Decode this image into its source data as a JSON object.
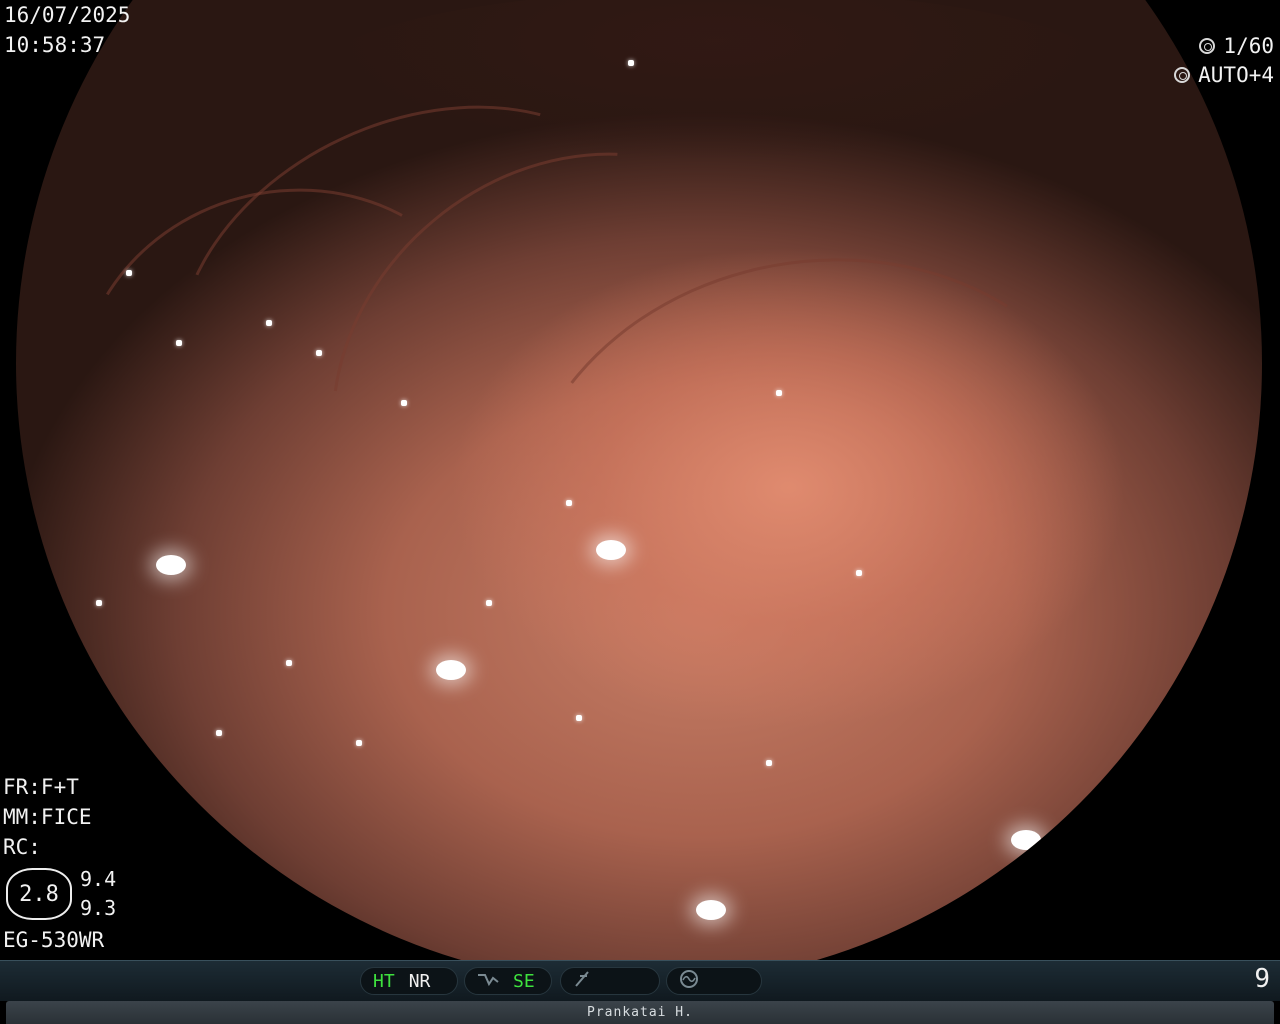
{
  "osd": {
    "date": "16/07/2025",
    "time": "10:58:37",
    "shutter": "1/60",
    "gain": "AUTO+4",
    "fr": "FR:F+T",
    "mm": "MM:FICE",
    "rc": "RC:",
    "zoom": "2.8",
    "zoom_a": "9.4",
    "zoom_b": "9.3",
    "scope_model": "EG-530WR"
  },
  "status_bar": {
    "ht": "HT",
    "nr": "NR",
    "se": "SE",
    "page_number": "9"
  },
  "patient": {
    "name": "Prankatai H."
  },
  "colors": {
    "osd_text": "#f2f2f2",
    "active_indicator": "#3ee13e",
    "status_bar_bg": "#10191f"
  },
  "icons": {
    "shutter": "aperture-icon",
    "gain": "gain-icon",
    "se_toggle": "curve-icon",
    "filter": "filter-icon",
    "spectrum": "wave-circle-icon"
  }
}
